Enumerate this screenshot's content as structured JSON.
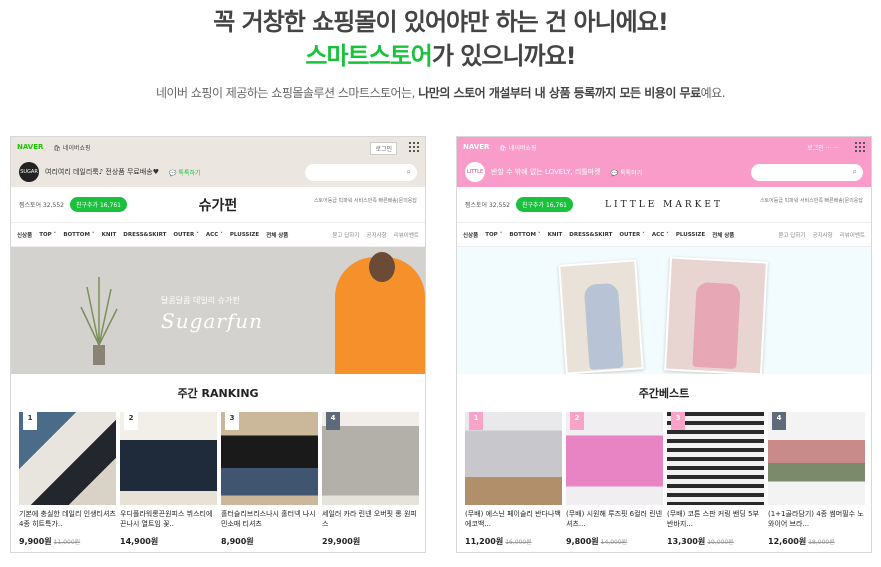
{
  "hero": {
    "line1": "꼭 거창한 쇼핑몰이 있어야만 하는 건 아니에요!",
    "line2_accent": "스마트스토어",
    "line2_rest": "가 있으니까요!",
    "subtitle_plain1": "네이버 쇼핑이 제공하는 쇼핑몰솔루션 스마트스토어는, ",
    "subtitle_bold": "나만의 스토어 개설부터 내 상품 등록까지 모든 비용이 무료",
    "subtitle_plain2": "예요."
  },
  "stores": [
    {
      "topbar": {
        "naver": "NAVER",
        "shopping": "네이버쇼핑",
        "login": "로그인"
      },
      "avatar_text": "SUGAR",
      "slogan": "여리여리 데일리룩♪ 전상품 무료배송♥",
      "talk": "톡톡하기",
      "followers": "찜스토어 32,552",
      "follow_btn": "친구추가 16,761",
      "title": "슈가펀",
      "meta": "스토어등급  빅파워  서비스만족  빠른배송|문의응답",
      "nav": [
        "신상품",
        "TOP ˅",
        "BOTTOM ˅",
        "KNIT",
        "DRESS&SKIRT",
        "OUTER ˅",
        "ACC ˅",
        "PLUSSIZE",
        "전체 상품"
      ],
      "nav_sub": [
        "묻고 답하기",
        "공지사항",
        "리뷰이벤트"
      ],
      "banner_sub": "달콤달콤 데일리 슈가펀",
      "banner_script": "Sugarfun",
      "section_title": "주간 RANKING",
      "products": [
        {
          "rank": "1",
          "name": "기본에 충실한 데일리 인생티셔츠 4종 히트특가..",
          "price": "9,900원",
          "old": "11,000원"
        },
        {
          "rank": "2",
          "name": "우디플라워롱끈원피스 뷔스티에 끈나시 열트임 꽃..",
          "price": "14,900원",
          "old": ""
        },
        {
          "rank": "3",
          "name": "홀터슬리브리스나시 홀터넥 나시 민소매 티셔츠",
          "price": "8,900원",
          "old": ""
        },
        {
          "rank": "4",
          "name": "세일러 카라 린넨 오버핏 롱 원피스",
          "price": "29,900원",
          "old": ""
        }
      ]
    },
    {
      "topbar": {
        "naver": "NAVER",
        "shopping": "네이버쇼핑",
        "login": "로그인  ···  ···"
      },
      "avatar_text": "LITTLE",
      "slogan": "반할 수 밖에 없는 LOVELY, 리틀마켓",
      "talk": "톡톡하기",
      "followers": "찜스토어 32,552",
      "follow_btn": "친구추가 16,761",
      "title": "LITTLE MARKET",
      "meta": "스토어등급  빅파워  서비스만족  빠른배송|문의응답",
      "nav": [
        "신상품",
        "TOP ˅",
        "BOTTOM ˅",
        "KNIT",
        "DRESS&SKIRT",
        "OUTER ˅",
        "ACC ˅",
        "PLUSSIZE",
        "전체 상품"
      ],
      "nav_sub": [
        "묻고 답하기",
        "공지사항",
        "리뷰이벤트"
      ],
      "section_title": "주간베스트",
      "products": [
        {
          "rank": "1",
          "name": "(무배) 에스닌 페이슬리 반다나백 에코백...",
          "price": "11,200원",
          "old": "16,000원"
        },
        {
          "rank": "2",
          "name": "(무배) 시원해 루즈핏 6컬러 린넨셔츠...",
          "price": "9,800원",
          "old": "14,000원"
        },
        {
          "rank": "3",
          "name": "(무배) 코튼 스판 커링 밴딩 5부 반바지...",
          "price": "13,300원",
          "old": "19,000원"
        },
        {
          "rank": "4",
          "name": "(1+1골라담기) 4종 썸머필수 노와이어 브라...",
          "price": "12,600원",
          "old": "18,000원"
        }
      ]
    }
  ],
  "colors": {
    "naver_green": "#19c13c",
    "left_bg": "#ebe6df",
    "right_bg": "#f99cc9"
  }
}
